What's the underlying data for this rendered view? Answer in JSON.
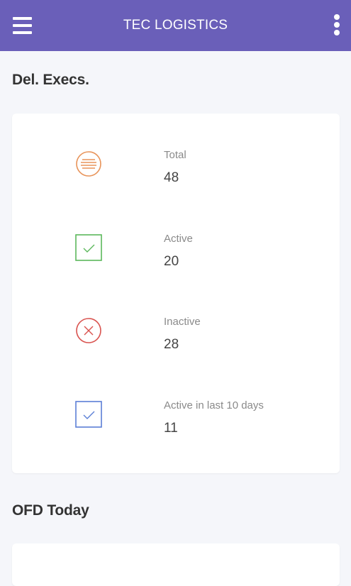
{
  "appbar": {
    "title": "TEC LOGISTICS",
    "menu_icon": "hamburger-menu-icon",
    "more_icon": "more-vertical-icon",
    "color": "#6a5fb9"
  },
  "sections": {
    "del_execs": {
      "title": "Del. Execs.",
      "stats": [
        {
          "label": "Total",
          "value": "48",
          "icon": "list-circle-icon",
          "color": "#e8945a"
        },
        {
          "label": "Active",
          "value": "20",
          "icon": "check-square-icon",
          "color": "#5cb85c"
        },
        {
          "label": "Inactive",
          "value": "28",
          "icon": "x-circle-icon",
          "color": "#d9534f"
        },
        {
          "label": "Active in last 10 days",
          "value": "11",
          "icon": "check-square-icon",
          "color": "#5b7fd6"
        }
      ]
    },
    "ofd_today": {
      "title": "OFD Today"
    }
  }
}
